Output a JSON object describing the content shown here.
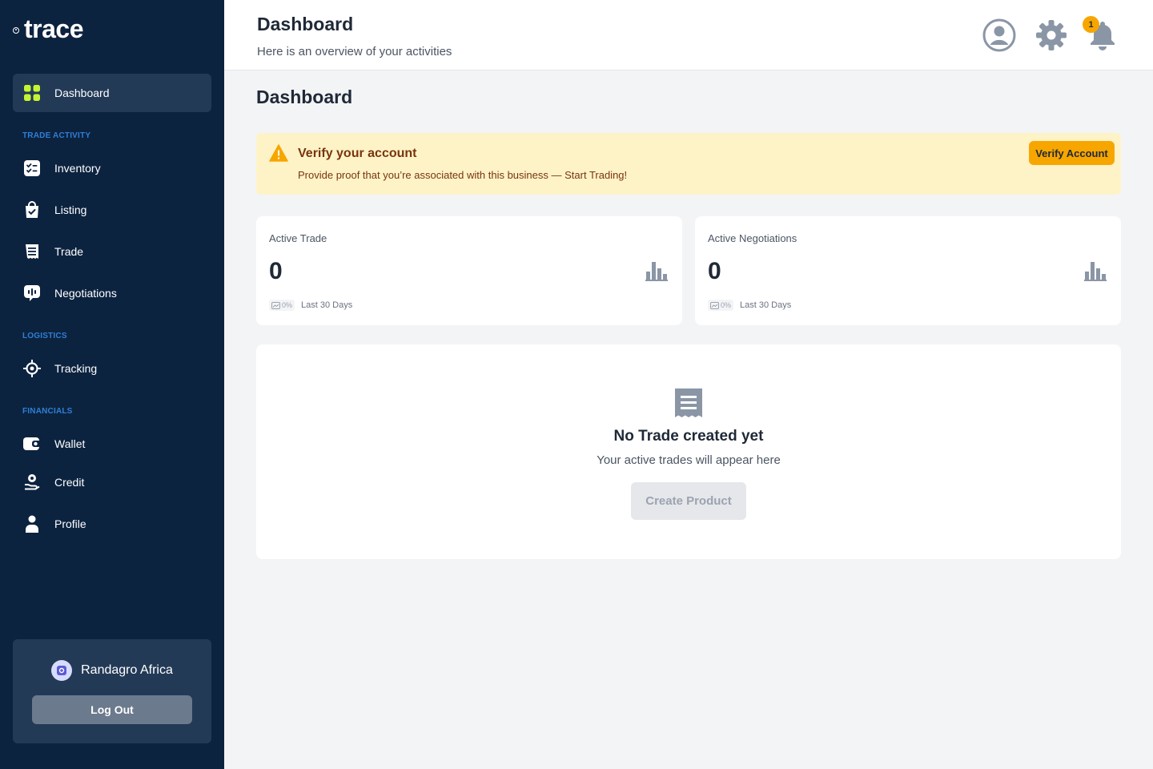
{
  "brand": {
    "name": "trace"
  },
  "sidebar": {
    "items": [
      {
        "label": "Dashboard",
        "icon": "dashboard-grid-icon"
      },
      {
        "label": "Inventory",
        "icon": "inventory-checklist-icon"
      },
      {
        "label": "Listing",
        "icon": "shopping-bag-check-icon"
      },
      {
        "label": "Trade",
        "icon": "receipt-icon"
      },
      {
        "label": "Negotiations",
        "icon": "chat-bubble-icon"
      },
      {
        "label": "Tracking",
        "icon": "location-target-icon"
      },
      {
        "label": "Wallet",
        "icon": "wallet-icon"
      },
      {
        "label": "Credit",
        "icon": "hand-coin-icon"
      },
      {
        "label": "Profile",
        "icon": "user-icon"
      }
    ],
    "sections": {
      "trade_activity": "TRADE ACTIVITY",
      "logistics": "LOGISTICS",
      "financials": "FINANCIALS"
    },
    "user": {
      "name": "Randagro Africa",
      "logout_label": "Log Out"
    }
  },
  "header": {
    "title": "Dashboard",
    "subtitle": "Here is an overview of your activities",
    "notification_count": "1"
  },
  "main": {
    "title": "Dashboard",
    "alert": {
      "title": "Verify your account",
      "description": "Provide proof that you’re associated with this business — Start Trading!",
      "button_label": "Verify Account"
    },
    "stats": [
      {
        "label": "Active Trade",
        "value": "0",
        "change": "0%",
        "period": "Last 30 Days"
      },
      {
        "label": "Active Negotiations",
        "value": "0",
        "change": "0%",
        "period": "Last 30 Days"
      }
    ],
    "empty_state": {
      "title": "No Trade created yet",
      "subtitle": "Your active trades will appear here",
      "button_label": "Create Product"
    }
  },
  "colors": {
    "sidebar_bg": "#0c2340",
    "accent_lime": "#c6f432",
    "section_label": "#2f7fd6",
    "warning_bg": "#fef3c7",
    "warning_button": "#f7a600"
  }
}
